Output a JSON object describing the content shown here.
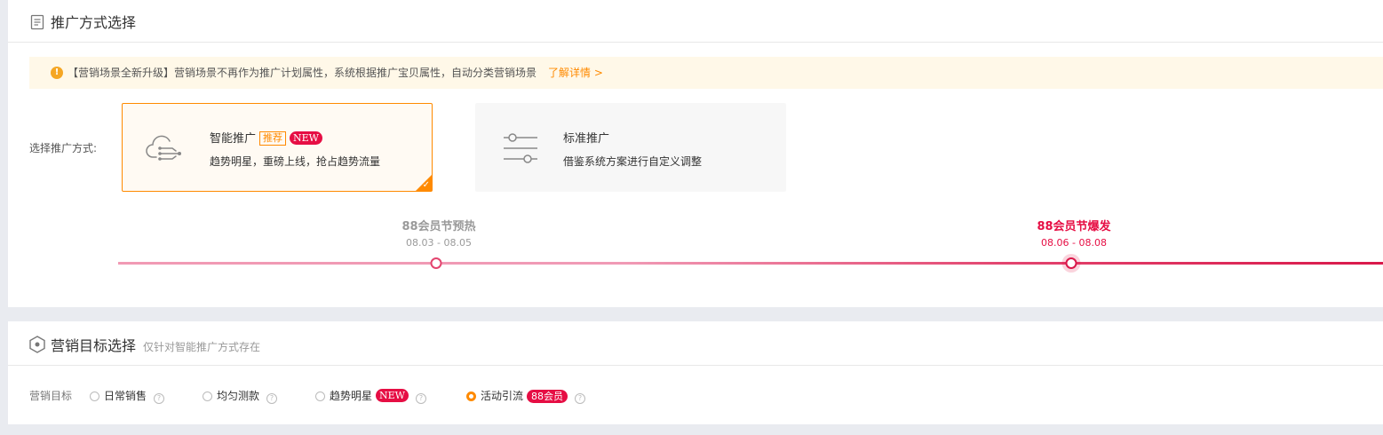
{
  "section1": {
    "title": "推广方式选择",
    "notice": {
      "icon": "info-icon",
      "text": "【营销场景全新升级】营销场景不再作为推广计划属性，系统根据推广宝贝属性，自动分类营销场景",
      "link": "了解详情 >"
    },
    "method_label": "选择推广方式:",
    "cards": [
      {
        "title": "智能推广",
        "tag": "推荐",
        "badge": "NEW",
        "desc": "趋势明星，重磅上线，抢占趋势流量",
        "icon": "cloud-flow-icon",
        "selected": true
      },
      {
        "title": "标准推广",
        "desc": "借鉴系统方案进行自定义调整",
        "icon": "sliders-icon",
        "selected": false
      }
    ],
    "timeline": [
      {
        "name": "88会员节预热",
        "date": "08.03 - 08.05",
        "color": "#9a9a9a",
        "active": false
      },
      {
        "name": "88会员节爆发",
        "date": "08.06 - 08.08",
        "color": "#e60e44",
        "active": true
      }
    ]
  },
  "section2": {
    "title": "营销目标选择",
    "subtitle": "仅针对智能推广方式存在",
    "goal_label": "营销目标",
    "goals": [
      {
        "label": "日常销售",
        "checked": false
      },
      {
        "label": "均匀测款",
        "checked": false
      },
      {
        "label": "趋势明星",
        "badge": "NEW",
        "checked": false
      },
      {
        "label": "活动引流",
        "badge": "88会员",
        "checked": true
      }
    ],
    "help_glyph": "?"
  },
  "colors": {
    "accent": "#ff8a00",
    "brand_red": "#e60e44",
    "notice_bg": "#fff8e8"
  }
}
